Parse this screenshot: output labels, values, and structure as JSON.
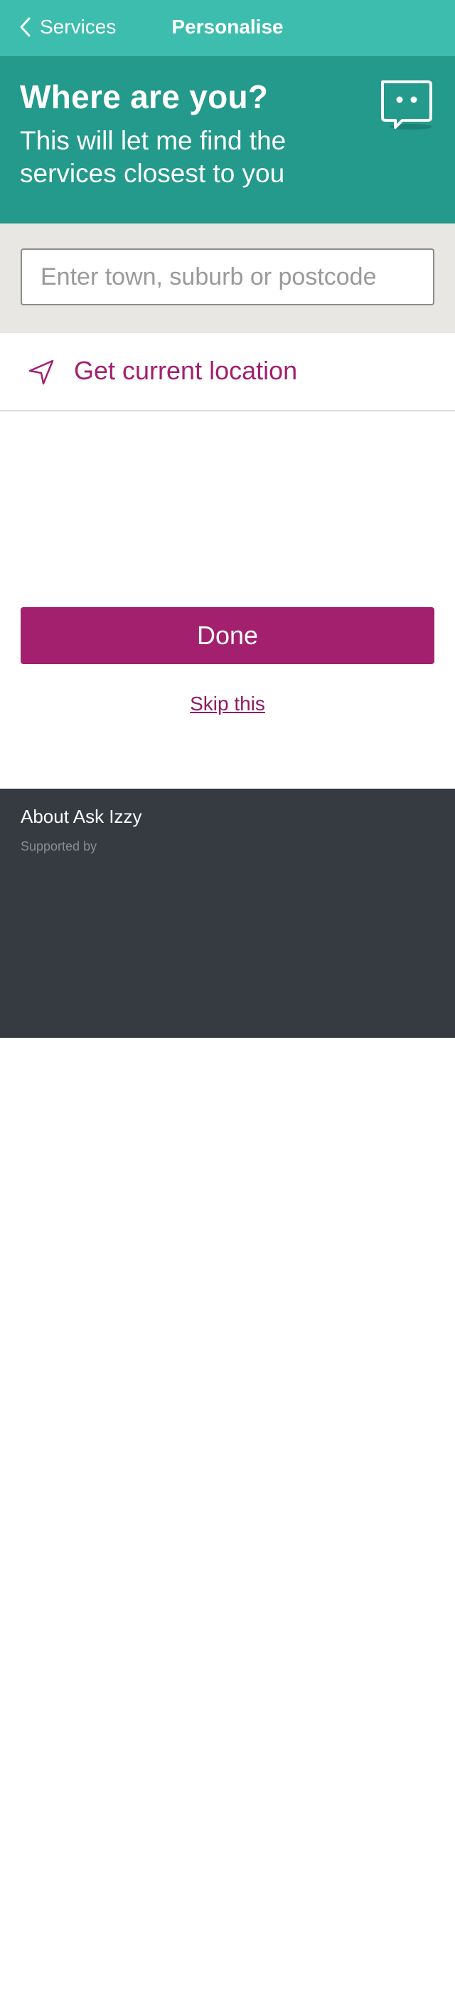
{
  "appbar": {
    "back_label": "Services",
    "title": "Personalise"
  },
  "hero": {
    "heading": "Where are you?",
    "subheading": "This will let me find the services closest to you"
  },
  "search": {
    "placeholder": "Enter town, suburb or postcode",
    "value": ""
  },
  "location": {
    "label": "Get current location"
  },
  "actions": {
    "done_label": "Done",
    "skip_label": "Skip this"
  },
  "footer": {
    "about_label": "About Ask Izzy",
    "supported_by": "Supported by"
  },
  "colors": {
    "appbar_bg": "#3dbdad",
    "hero_bg": "#239a8b",
    "accent": "#a3206f",
    "search_band_bg": "#e8e7e4",
    "footer_bg": "#363a41"
  },
  "icons": {
    "back": "chevron-left-icon",
    "chat": "chat-bubble-icon",
    "location": "location-arrow-icon"
  }
}
